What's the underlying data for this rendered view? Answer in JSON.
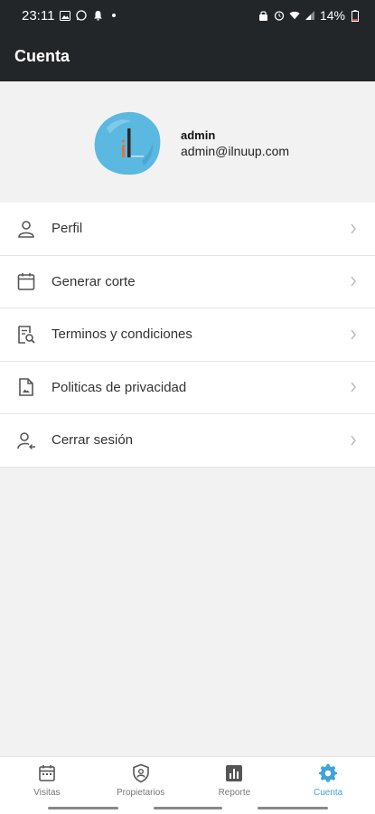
{
  "status_bar": {
    "time": "23:11",
    "battery": "14%"
  },
  "app_bar": {
    "title": "Cuenta"
  },
  "profile": {
    "name": "admin",
    "email": "admin@ilnuup.com",
    "avatar_icon": "company-logo-icon"
  },
  "menu": {
    "items": [
      {
        "label": "Perfil",
        "icon": "user-icon"
      },
      {
        "label": "Generar corte",
        "icon": "calendar-icon"
      },
      {
        "label": "Terminos y condiciones",
        "icon": "document-search-icon"
      },
      {
        "label": "Politicas de privacidad",
        "icon": "document-image-icon"
      },
      {
        "label": "Cerrar sesión",
        "icon": "user-logout-icon"
      }
    ]
  },
  "bottom_nav": {
    "items": [
      {
        "label": "Visitas",
        "icon": "calendar-icon",
        "active": false
      },
      {
        "label": "Propietarios",
        "icon": "shield-user-icon",
        "active": false
      },
      {
        "label": "Reporte",
        "icon": "bar-chart-icon",
        "active": false
      },
      {
        "label": "Cuenta",
        "icon": "gear-icon",
        "active": true
      }
    ]
  },
  "colors": {
    "app_bar": "#232629",
    "accent": "#3fa4d8",
    "background": "#f2f2f2"
  }
}
